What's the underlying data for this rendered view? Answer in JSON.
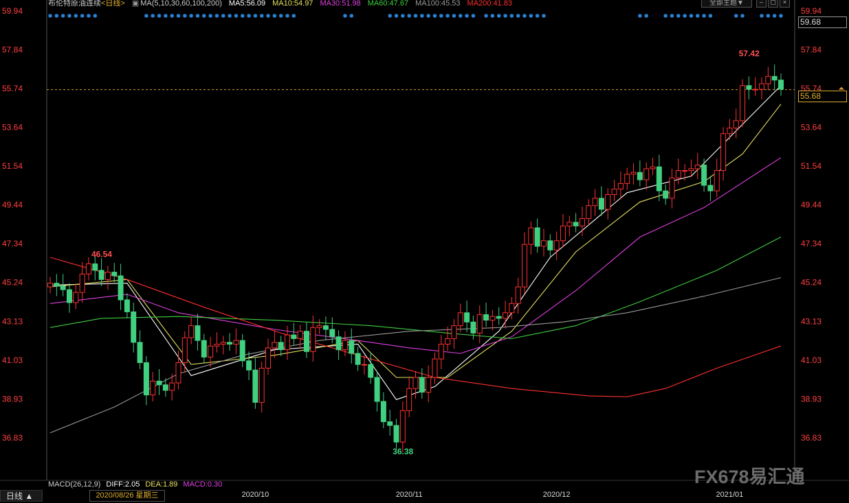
{
  "header": {
    "title": "布伦特原油连续",
    "period_tag": "<日线>",
    "ma_label": "MA(5,10,30,60,100,200)",
    "ma5": "MA5:56.09",
    "ma10": "MA10:54.97",
    "ma30": "MA30:51.98",
    "ma60": "MA60:47.67",
    "ma100": "MA100:45.53",
    "ma200": "MA200:41.83",
    "theme_button": "全部主题▼"
  },
  "price_boxes": {
    "top": "59.68",
    "current": "55.68"
  },
  "footer": {
    "macd": "MACD(26,12,9)",
    "diff": "DIFF:2.05",
    "dea": "DEA:1.89",
    "macd_val": "MACD:0.30",
    "date": "2020/08/26 星期三",
    "period_button": "日线 ▲"
  },
  "watermark": "FX678易汇通",
  "colors": {
    "up": "#ff3232",
    "down": "#40d080",
    "ma5": "#ffffff",
    "ma10": "#e8e060",
    "ma30": "#e040e0",
    "ma60": "#40d040",
    "ma100": "#9a9a9a",
    "ma200": "#ff3030",
    "axis_text": "#ff4040",
    "header_text": "#cccccc"
  },
  "chart_data": {
    "type": "candlestick",
    "y_ticks": [
      59.94,
      57.84,
      55.74,
      53.64,
      51.54,
      49.44,
      47.34,
      45.24,
      43.13,
      41.03,
      38.93,
      36.83
    ],
    "ylim": [
      36.83,
      59.94
    ],
    "x_labels": [
      "2020/10",
      "2020/11",
      "2020/12",
      "2021/01"
    ],
    "current_price": 55.68,
    "annotations": [
      {
        "text": "46.54",
        "price": 46.54,
        "type": "high"
      },
      {
        "text": "36.38",
        "price": 36.38,
        "type": "low"
      },
      {
        "text": "57.42",
        "price": 57.42,
        "type": "high"
      }
    ],
    "close": [
      45.2,
      45.05,
      44.85,
      44.15,
      44.7,
      45.7,
      46.25,
      45.9,
      45.4,
      45.8,
      45.6,
      44.3,
      43.65,
      42.0,
      40.9,
      39.15,
      39.9,
      39.7,
      39.4,
      39.8,
      40.9,
      42.25,
      42.9,
      42.1,
      41.2,
      41.8,
      41.9,
      42.0,
      41.9,
      42.1,
      41.0,
      40.5,
      38.75,
      40.6,
      41.7,
      42.0,
      41.6,
      42.4,
      42.2,
      42.6,
      41.5,
      42.8,
      42.9,
      42.7,
      42.3,
      41.6,
      42.1,
      41.4,
      40.8,
      40.8,
      40.1,
      38.8,
      37.7,
      37.5,
      36.6,
      38.3,
      39.5,
      40.1,
      39.3,
      40.1,
      41.1,
      41.9,
      42.2,
      42.9,
      43.6,
      43.1,
      42.5,
      43.5,
      43.2,
      43.4,
      43.3,
      43.6,
      44.1,
      45.0,
      47.3,
      48.2,
      47.2,
      47.5,
      47.0,
      47.5,
      48.3,
      48.5,
      48.3,
      48.7,
      49.4,
      49.8,
      49.2,
      50.0,
      50.3,
      50.6,
      51.1,
      51.2,
      50.8,
      51.4,
      51.5,
      50.2,
      49.8,
      50.9,
      51.3,
      51.3,
      51.4,
      51.6,
      50.5,
      50.2,
      51.3,
      53.3,
      53.6,
      54.0,
      55.9,
      55.7,
      55.7,
      56.0,
      56.4,
      56.2,
      55.7
    ],
    "open": [
      45.0,
      45.2,
      45.05,
      44.85,
      44.15,
      44.7,
      45.7,
      46.25,
      45.9,
      45.4,
      45.8,
      45.6,
      44.3,
      43.65,
      42.0,
      40.9,
      39.15,
      39.9,
      39.7,
      39.4,
      39.8,
      40.9,
      42.25,
      42.9,
      42.1,
      41.2,
      41.8,
      41.9,
      42.0,
      41.9,
      42.1,
      41.0,
      40.5,
      38.75,
      40.6,
      41.7,
      42.0,
      41.6,
      42.4,
      42.2,
      42.6,
      41.5,
      42.8,
      42.9,
      42.7,
      42.3,
      41.6,
      42.1,
      41.4,
      40.8,
      40.8,
      40.1,
      38.8,
      37.7,
      37.5,
      36.6,
      38.3,
      39.5,
      40.1,
      39.3,
      40.1,
      41.1,
      41.9,
      42.2,
      42.9,
      43.6,
      43.1,
      42.5,
      43.5,
      43.2,
      43.4,
      43.3,
      43.6,
      44.1,
      45.0,
      47.3,
      48.2,
      47.2,
      47.5,
      47.0,
      47.5,
      48.3,
      48.5,
      48.3,
      48.7,
      49.4,
      49.8,
      49.2,
      50.0,
      50.3,
      50.6,
      51.1,
      51.2,
      50.8,
      51.4,
      51.5,
      50.2,
      49.8,
      50.9,
      51.3,
      51.3,
      51.4,
      51.6,
      50.5,
      50.2,
      51.3,
      53.3,
      53.6,
      54.0,
      55.9,
      55.7,
      55.7,
      56.0,
      56.4,
      56.2
    ],
    "series": [
      {
        "name": "MA5",
        "values": [
          [
            0,
            45.1
          ],
          [
            12,
            45.2
          ],
          [
            22,
            40.2
          ],
          [
            35,
            41.6
          ],
          [
            48,
            41.9
          ],
          [
            54,
            38.9
          ],
          [
            60,
            39.6
          ],
          [
            70,
            42.6
          ],
          [
            78,
            46.6
          ],
          [
            90,
            50.1
          ],
          [
            100,
            51.0
          ],
          [
            108,
            53.8
          ],
          [
            114,
            55.9
          ]
        ]
      },
      {
        "name": "MA10",
        "values": [
          [
            0,
            45.0
          ],
          [
            12,
            45.4
          ],
          [
            22,
            40.8
          ],
          [
            35,
            41.3
          ],
          [
            48,
            42.1
          ],
          [
            54,
            40.1
          ],
          [
            62,
            40.1
          ],
          [
            72,
            42.6
          ],
          [
            82,
            46.9
          ],
          [
            92,
            49.6
          ],
          [
            102,
            50.7
          ],
          [
            108,
            52.2
          ],
          [
            114,
            54.9
          ]
        ]
      },
      {
        "name": "MA30",
        "values": [
          [
            0,
            44.1
          ],
          [
            12,
            44.6
          ],
          [
            20,
            43.6
          ],
          [
            35,
            42.7
          ],
          [
            48,
            42.1
          ],
          [
            56,
            41.7
          ],
          [
            64,
            41.4
          ],
          [
            72,
            42.3
          ],
          [
            82,
            44.8
          ],
          [
            92,
            47.7
          ],
          [
            102,
            49.3
          ],
          [
            114,
            52.0
          ]
        ]
      },
      {
        "name": "MA60",
        "values": [
          [
            0,
            42.8
          ],
          [
            8,
            43.3
          ],
          [
            20,
            43.4
          ],
          [
            35,
            43.2
          ],
          [
            50,
            42.9
          ],
          [
            62,
            42.5
          ],
          [
            72,
            42.2
          ],
          [
            82,
            42.9
          ],
          [
            92,
            44.2
          ],
          [
            104,
            45.9
          ],
          [
            114,
            47.7
          ]
        ]
      },
      {
        "name": "MA100",
        "values": [
          [
            0,
            37.1
          ],
          [
            10,
            38.5
          ],
          [
            20,
            40.3
          ],
          [
            30,
            41.3
          ],
          [
            42,
            42.1
          ],
          [
            56,
            42.6
          ],
          [
            70,
            42.8
          ],
          [
            80,
            43.1
          ],
          [
            90,
            43.6
          ],
          [
            102,
            44.5
          ],
          [
            114,
            45.5
          ]
        ]
      },
      {
        "name": "MA200",
        "values": [
          [
            0,
            46.6
          ],
          [
            12,
            45.4
          ],
          [
            24,
            43.9
          ],
          [
            36,
            42.5
          ],
          [
            48,
            41.3
          ],
          [
            60,
            40.1
          ],
          [
            72,
            39.5
          ],
          [
            84,
            39.1
          ],
          [
            90,
            39.05
          ],
          [
            96,
            39.5
          ],
          [
            104,
            40.6
          ],
          [
            114,
            41.8
          ]
        ]
      }
    ]
  }
}
